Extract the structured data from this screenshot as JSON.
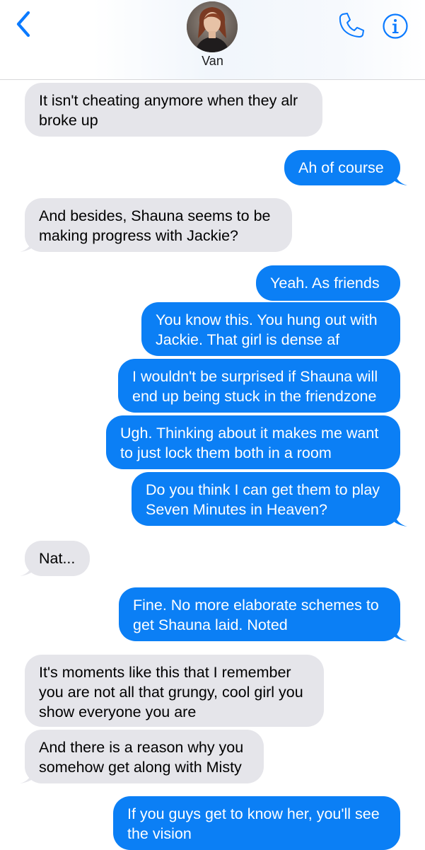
{
  "header": {
    "contact_name": "Van",
    "back_icon": "chevron-left-icon",
    "call_icon": "phone-icon",
    "info_icon": "info-icon"
  },
  "colors": {
    "outgoing": "#0b7ff5",
    "incoming": "#e5e5ea",
    "accent": "#0a7aff"
  },
  "messages": [
    {
      "from": "contact",
      "text": "It isn't cheating anymore when they alr broke up"
    },
    {
      "from": "me",
      "text": "Ah of course"
    },
    {
      "from": "contact",
      "text": "And besides, Shauna seems to be making progress with Jackie?"
    },
    {
      "from": "me",
      "text": "Yeah. As friends"
    },
    {
      "from": "me",
      "text": "You know this. You hung out with Jackie. That girl is dense af"
    },
    {
      "from": "me",
      "text": "I wouldn't be surprised if Shauna will end up being stuck in the friendzone"
    },
    {
      "from": "me",
      "text": "Ugh. Thinking about it makes me want to just lock them both in a room"
    },
    {
      "from": "me",
      "text": "Do you think I can get them to play Seven Minutes in Heaven?"
    },
    {
      "from": "contact",
      "text": "Nat..."
    },
    {
      "from": "me",
      "text": "Fine. No more elaborate schemes to get Shauna laid. Noted"
    },
    {
      "from": "contact",
      "text": "It's moments like this that I remember you are not all that grungy, cool girl you show everyone you are"
    },
    {
      "from": "contact",
      "text": "And there is a reason why you somehow get along with Misty"
    },
    {
      "from": "me",
      "text": "If you guys get to know her, you'll see the vision"
    }
  ]
}
